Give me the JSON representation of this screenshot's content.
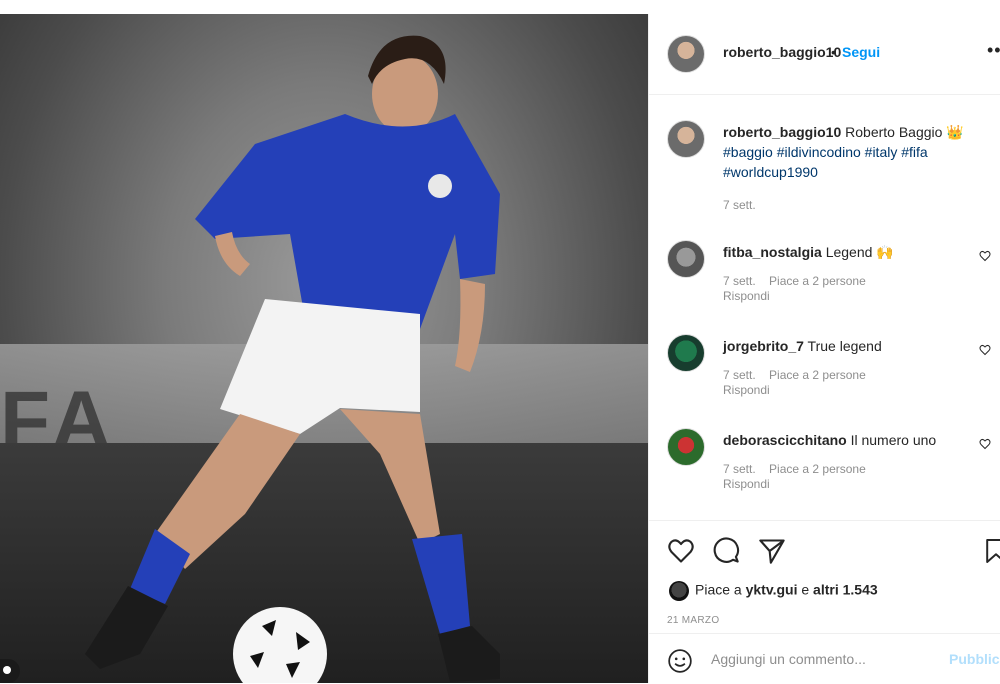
{
  "post": {
    "username": "roberto_baggio10",
    "separator": "•",
    "follow_label": "Segui",
    "more_label": "•••"
  },
  "photo": {
    "banner_text": "FA"
  },
  "caption": {
    "username": "roberto_baggio10",
    "text": "Roberto Baggio",
    "emoji": "👑",
    "hashtags": "#baggio #ildivincodino #italy #fifa #worldcup1990",
    "time": "7 sett."
  },
  "comments": [
    {
      "username": "fitba_nostalgia",
      "text": "Legend",
      "emoji": "🙌",
      "time": "7 sett.",
      "likes": "Piace a 2 persone",
      "reply": "Rispondi"
    },
    {
      "username": "jorgebrito_7",
      "text": "True legend",
      "emoji": "",
      "time": "7 sett.",
      "likes": "Piace a 2 persone",
      "reply": "Rispondi"
    },
    {
      "username": "deborascicchitano",
      "text": "Il numero uno",
      "emoji": "",
      "time": "7 sett.",
      "likes": "Piace a 2 persone",
      "reply": "Rispondi"
    }
  ],
  "actions": {
    "likes_prefix": "Piace a",
    "likes_user": "yktv.gui",
    "likes_middle": "e",
    "likes_others": "altri 1.543",
    "date": "21 MARZO"
  },
  "add_comment": {
    "placeholder": "Aggiungi un commento...",
    "publish_label": "Pubblica"
  },
  "icons": {
    "like": "heart-icon",
    "comment": "comment-icon",
    "share": "paper-plane-icon",
    "save": "bookmark-icon",
    "emoji": "smiley-icon",
    "tag": "user-tag-icon"
  },
  "colors": {
    "link": "#0095f6",
    "hashtag": "#00376b",
    "muted": "#8e8e8e",
    "publish_disabled": "#b2dffc"
  }
}
